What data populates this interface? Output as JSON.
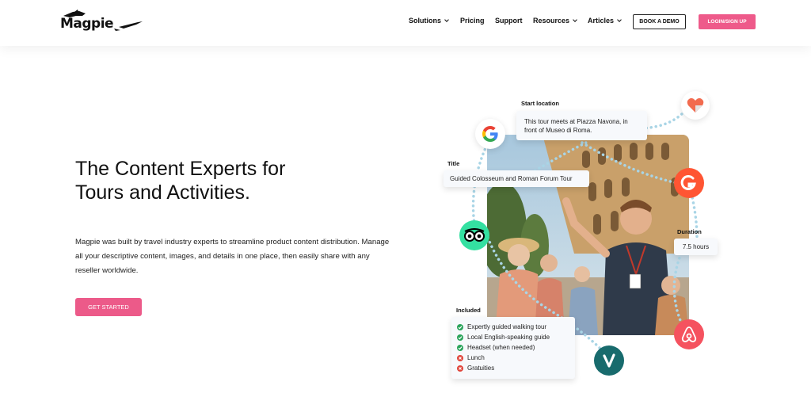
{
  "header": {
    "logo": "Magpie",
    "nav": [
      {
        "label": "Solutions",
        "dropdown": true
      },
      {
        "label": "Pricing",
        "dropdown": false
      },
      {
        "label": "Support",
        "dropdown": false
      },
      {
        "label": "Resources",
        "dropdown": true
      },
      {
        "label": "Articles",
        "dropdown": true
      }
    ],
    "book_demo": "BOOK A DEMO",
    "login": "LOGIN/SIGN UP"
  },
  "hero": {
    "title_line1": "The Content Experts for",
    "title_line2": "Tours and Activities.",
    "description": "Magpie was built by travel industry experts to streamline product content distribution. Manage all your descriptive content, images, and details in one place, then easily share with any reseller worldwide.",
    "cta": "GET STARTED"
  },
  "illustration": {
    "start_location": {
      "label": "Start location",
      "value": "This tour meets at Piazza Navona, in front of Museo di Roma."
    },
    "title": {
      "label": "Title",
      "value": "Guided Colosseum and Roman Forum Tour"
    },
    "duration": {
      "label": "Duration",
      "value": "7.5 hours"
    },
    "included": {
      "label": "Included",
      "items": [
        {
          "text": "Expertly guided walking tour",
          "included": true
        },
        {
          "text": "Local English-speaking guide",
          "included": true
        },
        {
          "text": "Headset (when needed)",
          "included": true
        },
        {
          "text": "Lunch",
          "included": false
        },
        {
          "text": "Gratuities",
          "included": false
        }
      ]
    },
    "partner_logos": [
      "google-icon",
      "heart-icon",
      "getyourguide-icon",
      "tripadvisor-icon",
      "airbnb-icon",
      "viator-icon"
    ]
  },
  "colors": {
    "accent": "#ec5a89",
    "included": "#2aa35a",
    "excluded": "#e0443a",
    "card_bg": "#f7f9fc",
    "dots": "#a9d5e6"
  }
}
